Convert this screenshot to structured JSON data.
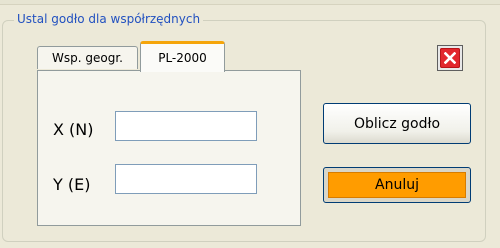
{
  "group": {
    "title": "Ustal godło dla współrzędnych"
  },
  "tabs": [
    {
      "label": "Wsp. geogr.",
      "active": false
    },
    {
      "label": "PL-2000",
      "active": true
    }
  ],
  "fields": {
    "x": {
      "label": "X (N)",
      "value": ""
    },
    "y": {
      "label": "Y (E)",
      "value": ""
    }
  },
  "buttons": {
    "calculate": "Oblicz godło",
    "cancel": "Anuluj",
    "close_icon": "close-x-icon"
  },
  "colors": {
    "legend_text": "#2251c0",
    "cancel_bg": "#ff9c00",
    "close_bg": "#e2272d",
    "active_tab_accent": "#f5a50a"
  }
}
